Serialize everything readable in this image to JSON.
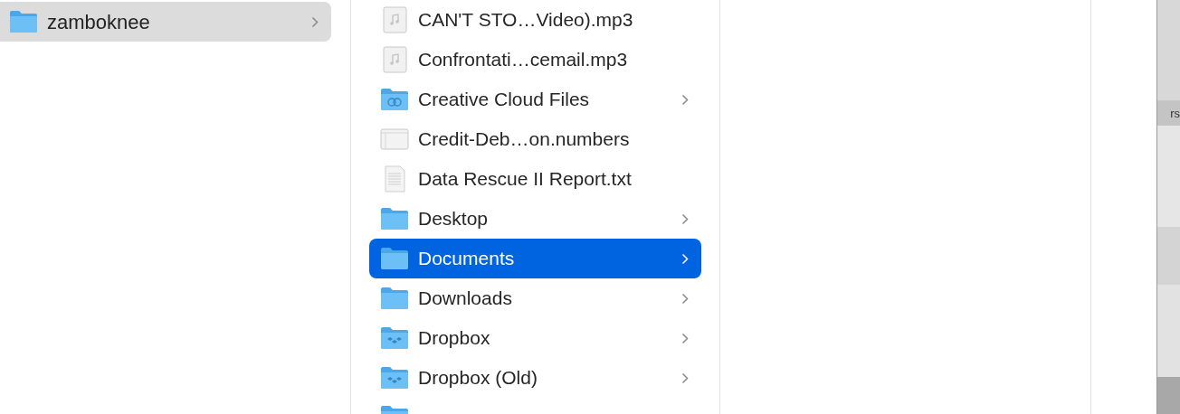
{
  "sidebar": {
    "items": [
      {
        "name": "zamboknee",
        "kind": "folder",
        "selected": true,
        "has_children": true
      }
    ]
  },
  "files": [
    {
      "name": "CAN'T STO…Video).mp3",
      "kind": "audio",
      "selected": false,
      "has_children": false
    },
    {
      "name": "Confrontati…cemail.mp3",
      "kind": "audio",
      "selected": false,
      "has_children": false
    },
    {
      "name": "Creative Cloud Files",
      "kind": "cloud-folder",
      "selected": false,
      "has_children": true
    },
    {
      "name": "Credit-Deb…on.numbers",
      "kind": "spreadsheet",
      "selected": false,
      "has_children": false
    },
    {
      "name": "Data Rescue II Report.txt",
      "kind": "text",
      "selected": false,
      "has_children": false
    },
    {
      "name": "Desktop",
      "kind": "folder",
      "selected": false,
      "has_children": true
    },
    {
      "name": "Documents",
      "kind": "folder",
      "selected": true,
      "has_children": true
    },
    {
      "name": "Downloads",
      "kind": "folder",
      "selected": false,
      "has_children": true
    },
    {
      "name": "Dropbox",
      "kind": "dropbox-folder",
      "selected": false,
      "has_children": true
    },
    {
      "name": "Dropbox (Old)",
      "kind": "dropbox-folder",
      "selected": false,
      "has_children": true
    }
  ],
  "background_window": {
    "label": "rs"
  }
}
